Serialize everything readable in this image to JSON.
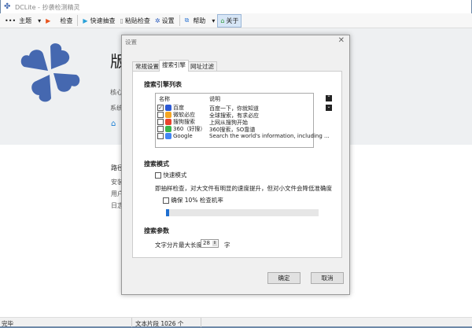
{
  "window": {
    "title": "DCLite - 抄袭检测精灵"
  },
  "toolbar": {
    "items": [
      {
        "label": "主题",
        "icon": "menu-dots-icon"
      },
      {
        "label": "检查",
        "icon": "play-icon"
      },
      {
        "label": "快速抽查",
        "icon": "play-icon"
      },
      {
        "label": "粘贴检查",
        "icon": "paste-icon"
      },
      {
        "label": "设置",
        "icon": "gear-icon"
      },
      {
        "label": "帮助",
        "icon": "help-icon"
      },
      {
        "label": "关于",
        "icon": "home-icon"
      }
    ]
  },
  "background": {
    "heading": "版",
    "lines": [
      "核心",
      "系统"
    ],
    "section": "路径",
    "items": [
      "安装",
      "用户",
      "日志"
    ]
  },
  "status": {
    "left": "完毕",
    "middle": "文本片段 1026 个"
  },
  "dialog": {
    "title": "设置",
    "tabs": [
      "常规设置",
      "搜索引擎",
      "网址过滤"
    ],
    "selected_tab": 1,
    "engine_list_title": "搜索引擎列表",
    "columns": [
      "名称",
      "说明"
    ],
    "engines": [
      {
        "name": "百度",
        "desc": "百度一下，你就知道",
        "checked": true,
        "color": "#2d5ad6"
      },
      {
        "name": "微软必应",
        "desc": "全球搜索，有求必应",
        "checked": false,
        "color": "#f5a623"
      },
      {
        "name": "搜狗搜索",
        "desc": "上网从搜狗开始",
        "checked": false,
        "color": "#e8432d"
      },
      {
        "name": "360（好搜）",
        "desc": "360搜索，SO靠谱",
        "checked": false,
        "color": "#3cb44b"
      },
      {
        "name": "Google",
        "desc": "Search the world's information, including ...",
        "checked": false,
        "color": "#4285f4"
      }
    ],
    "mode_title": "搜索模式",
    "fast_mode": {
      "label": "快速模式",
      "checked": false
    },
    "mode_desc": "即抽样检查，对大文件有明显的速度提升，但对小文件会降低准确度",
    "ensure": {
      "label": "确保 10% 检查机率",
      "checked": false
    },
    "slider_value": 0,
    "params_title": "搜索参数",
    "max_len_label": "文字分片最大长度",
    "max_len_value": "28",
    "max_len_unit": "字",
    "ok": "确定",
    "cancel": "取消"
  },
  "accent": "#2f6fc4"
}
